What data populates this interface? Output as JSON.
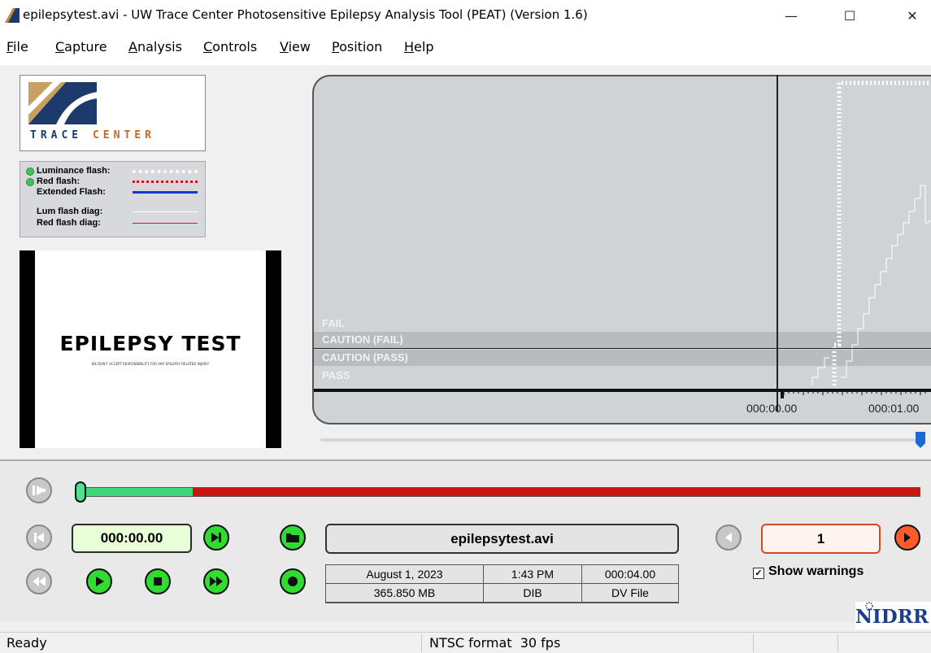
{
  "window": {
    "title": "epilepsytest.avi - UW Trace Center Photosensitive Epilepsy Analysis Tool (PEAT) (Version 1.6)",
    "minimize": "—",
    "maximize": "☐",
    "close": "✕"
  },
  "menu": [
    "File",
    "Capture",
    "Analysis",
    "Controls",
    "View",
    "Position",
    "Help"
  ],
  "logo": {
    "word1": "TRACE",
    "word2": "CENTER"
  },
  "legend": [
    {
      "label": "Luminance flash:",
      "dot": true
    },
    {
      "label": "Red flash:",
      "dot": true
    },
    {
      "label": "Extended Flash:",
      "dot": false
    },
    {
      "label": "Lum flash diag:",
      "dot": false
    },
    {
      "label": "Red flash diag:",
      "dot": false
    }
  ],
  "preview": {
    "title": "EPILEPSY TEST",
    "subtitle": "WE DON'T ACCEPT RESPONSIBILITY FOR ANY EPILEPSY RELATED INJURY!"
  },
  "graph": {
    "zones": [
      "FAIL",
      "CAUTION (FAIL)",
      "CAUTION (PASS)",
      "PASS"
    ],
    "time_labels": [
      "000:00.00",
      "000:01.00"
    ]
  },
  "controls": {
    "current_time": "000:00.00",
    "file_name": "epilepsytest.avi",
    "info": {
      "date": "August 1, 2023",
      "time": "1:43 PM",
      "duration": "000:04.00",
      "size": "365.850 MB",
      "codec": "DIB",
      "type": "DV File"
    },
    "warning_count": "1",
    "show_warnings": "Show warnings",
    "progress_fraction": 0.132
  },
  "nidrr": "NIDRR",
  "status": {
    "left": "Ready",
    "format": "NTSC format  30 fps"
  },
  "colors": {
    "green": "#2fdc2f",
    "red": "#c8150f",
    "blue_extended": "#1238d6"
  }
}
